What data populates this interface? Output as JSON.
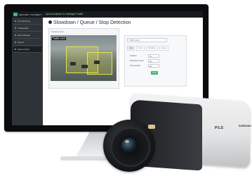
{
  "app": {
    "logo_text": "SECURITY CONNECT",
    "title": "Xpots Analytics for Intelligent Traffic"
  },
  "sidebar": {
    "items": [
      {
        "label": "Live Monitoring"
      },
      {
        "label": "Configuration"
      },
      {
        "label": "Event Manager"
      },
      {
        "label": "Reports"
      },
      {
        "label": "System Setup"
      }
    ],
    "active_index": 4
  },
  "main": {
    "page_title": "Slowdown / Queue / Stop Detection",
    "video_panel_title": "Camera view",
    "video_overlay": "Traffic zone",
    "settings": {
      "zone_select": "Traffic zone 1",
      "tabs": [
        "Area",
        "Rule",
        "Schedule",
        "Action"
      ],
      "active_tab": 0,
      "fields": [
        {
          "label": "Enabled",
          "value": "On"
        },
        {
          "label": "Slowdown speed",
          "value": "10"
        },
        {
          "label": "Stop duration",
          "value": "30"
        }
      ],
      "apply_label": "Apply"
    }
  },
  "camera": {
    "brand_mark": "P/LS",
    "brand_name": "SAMSUNG"
  }
}
